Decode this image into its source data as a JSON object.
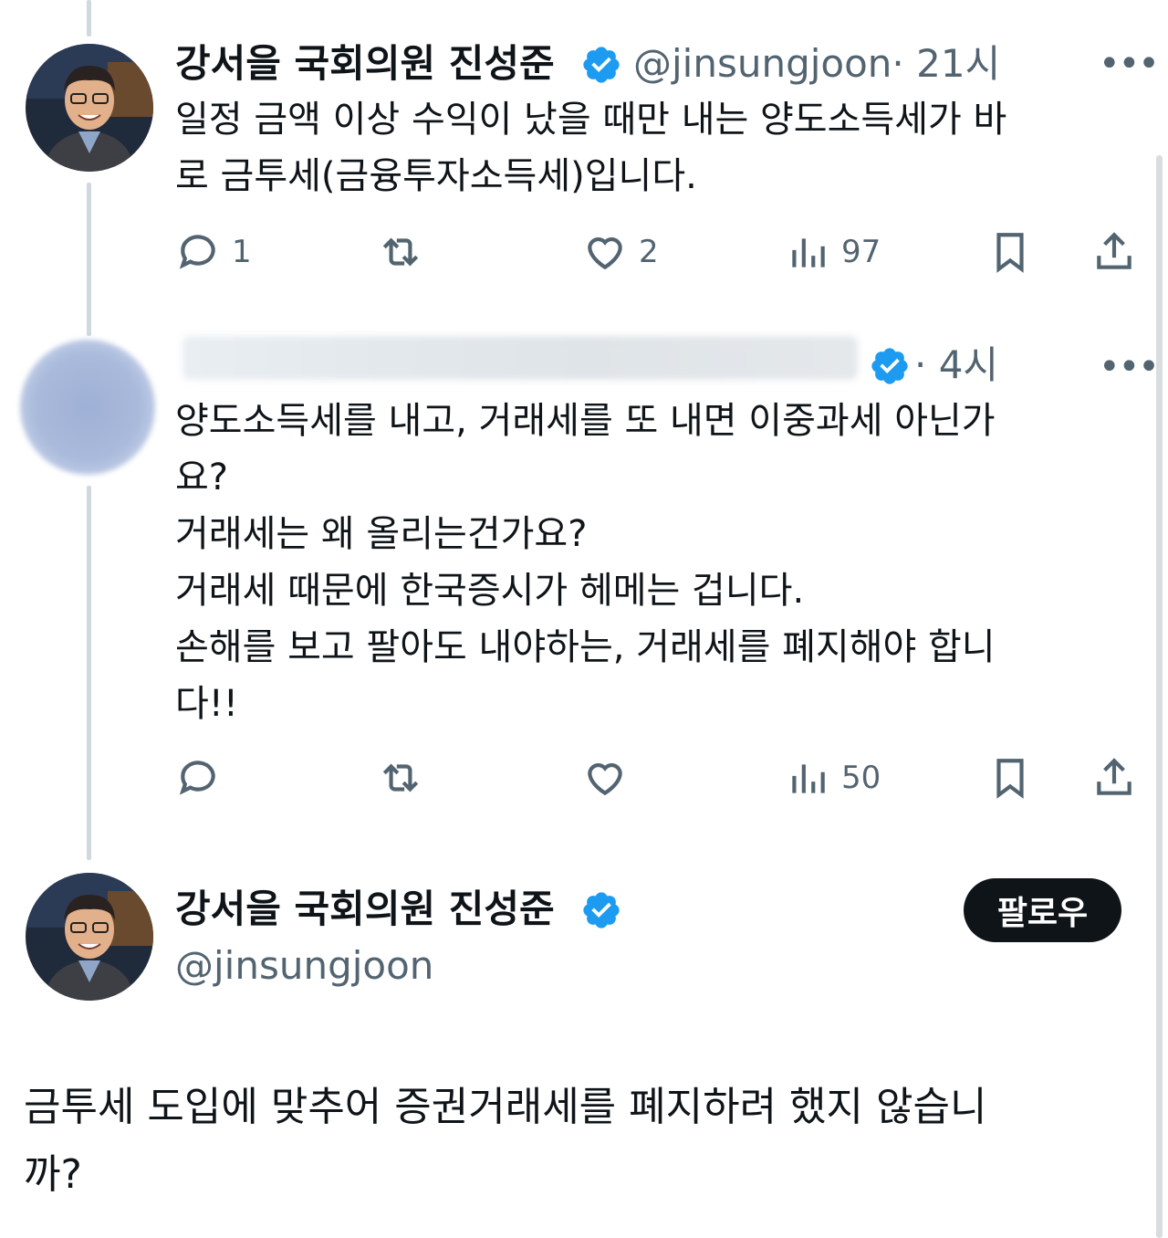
{
  "tweet1": {
    "author_name": "강서을 국회의원 진성준",
    "handle": "@jinsungjoon",
    "time": "· 21시",
    "text": "일정 금액 이상 수익이 났을 때만 내는 양도소득세가 바\n로 금투세(금융투자소득세)입니다.",
    "reply_count": "1",
    "like_count": "2",
    "view_count": "97"
  },
  "tweet2": {
    "time": "· 4시",
    "text": "양도소득세를 내고, 거래세를 또 내면 이중과세 아닌가\n요?\n거래세는 왜 올리는건가요?\n거래세 때문에 한국증시가 헤메는 겁니다.\n손해를 보고 팔아도 내야하는, 거래세를 폐지해야 합니\n다!!",
    "view_count": "50"
  },
  "tweet3": {
    "author_name": "강서을 국회의원 진성준",
    "handle": "@jinsungjoon",
    "follow_label": "팔로우",
    "text": "금투세 도입에 맞추어 증권거래세를 폐지하려 했지 않습니\n까?"
  },
  "more_label": "•••",
  "colors": {
    "verified": "#1d9bf0",
    "muted": "#536471",
    "text": "#0f1419"
  }
}
